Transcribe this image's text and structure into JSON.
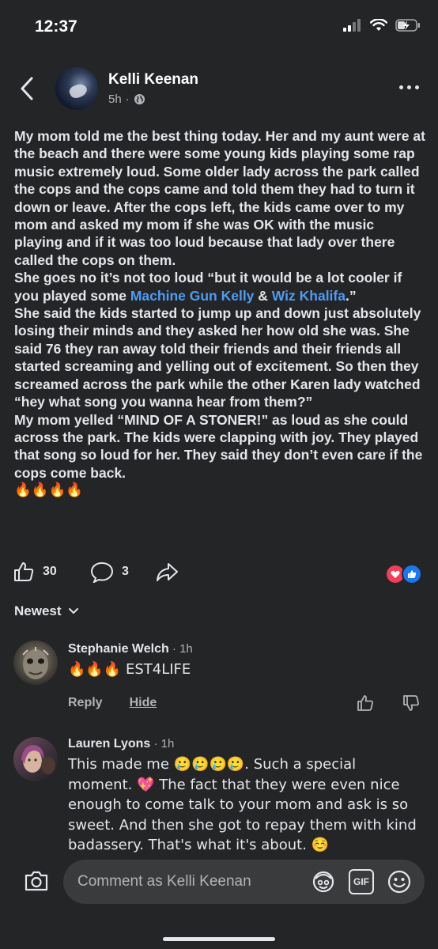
{
  "status_bar": {
    "time": "12:37"
  },
  "post": {
    "author": "Kelli Keenan",
    "time": "5h",
    "body": {
      "p1": "My mom told me the best thing today. Her and my aunt were at the beach and there were some young kids playing some rap music extremely loud. Some older lady across the park called the cops and the cops came and told them they had to turn it down or leave. After the cops left, the kids came over to my mom and asked my mom if she was OK with the music playing and if it was too loud because that lady over there called the cops on them.",
      "p2_start": "She goes no it’s not too loud “but it would be a lot cooler if you played some ",
      "mention1": "Machine Gun Kelly",
      "p2_mid": " &  ",
      "mention2": "Wiz Khalifa",
      "p2_end": ".”",
      "p3": " She said the kids started to jump up and down just absolutely losing their minds and they asked her how old she was. She said 76 they ran away told their friends and their friends all started screaming and yelling out of excitement. So then they screamed across the park while the other Karen lady watched “hey what song you wanna hear from them?”",
      "p4": "My mom yelled “MIND OF A STONER!” as loud as she could across the park. The kids were clapping with joy. They played that song so loud for her. They said they don’t even care if the cops come back.",
      "p5": "🔥🔥🔥🔥"
    },
    "like_count": "30",
    "comment_count": "3"
  },
  "comments_sort": {
    "label": "Newest"
  },
  "comments": [
    {
      "name": "Stephanie Welch",
      "time": " · 1h",
      "text": "🔥🔥🔥 EST4LIFE",
      "reply_label": "Reply",
      "hide_label": "Hide"
    },
    {
      "name": "Lauren Lyons",
      "time": " · 1h",
      "text": "This made me 🥲🥲🥲🥲. Such a special moment. 💖 The fact that they were even nice enough to come talk to your mom and ask is so sweet. And then she got to repay them with kind badassery. That's what it's about. ☺️"
    }
  ],
  "composer": {
    "placeholder": "Comment as Kelli Keenan",
    "gif_label": "GIF"
  },
  "colors": {
    "background": "#242526",
    "text": "#e4e6eb",
    "muted": "#b0b3b8",
    "link": "#4e9cf5",
    "like_blue": "#1877f2",
    "love_red": "#f33e58"
  }
}
